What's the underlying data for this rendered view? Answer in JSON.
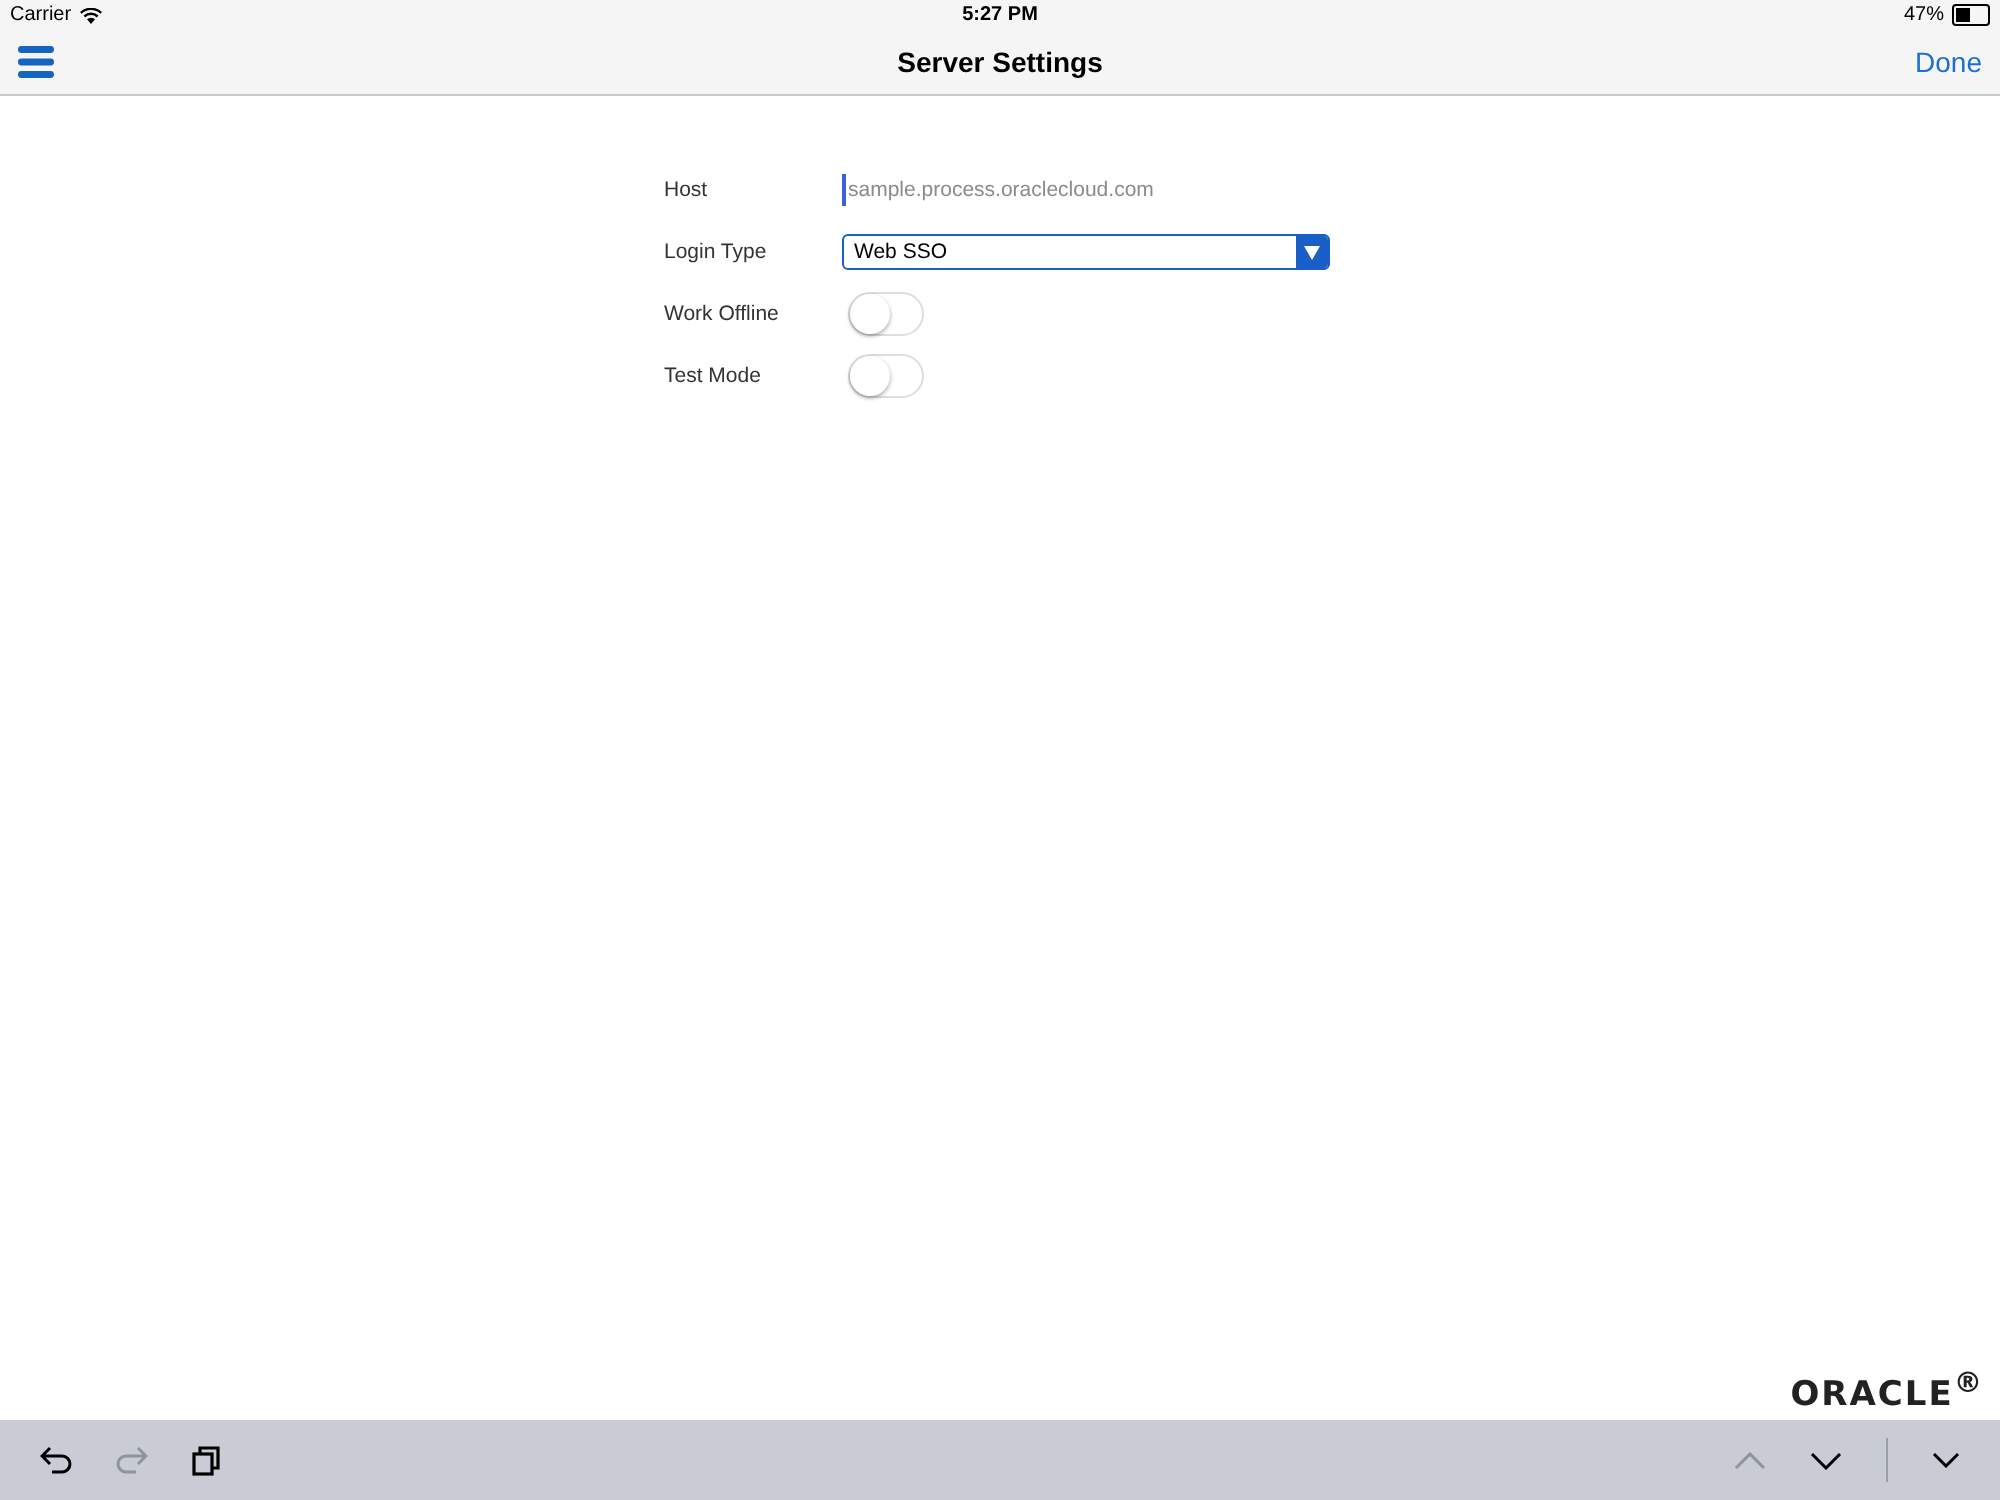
{
  "status_bar": {
    "carrier": "Carrier",
    "time": "5:27 PM",
    "battery": "47%"
  },
  "nav": {
    "title": "Server Settings",
    "done": "Done"
  },
  "form": [
    {
      "kind": "text",
      "label": "Host",
      "placeholder": "sample.process.oraclecloud.com"
    },
    {
      "kind": "select",
      "label": "Login Type",
      "value": "Web SSO"
    },
    {
      "kind": "toggle",
      "label": "Work Offline",
      "on": false
    },
    {
      "kind": "toggle",
      "label": "Test Mode",
      "on": false
    }
  ],
  "logo": "ORACLE$^{®}$",
  "toolbar": {
    "undo_disabled": false,
    "redo_disabled": true,
    "prev_disabled": true,
    "next_disabled": false
  }
}
